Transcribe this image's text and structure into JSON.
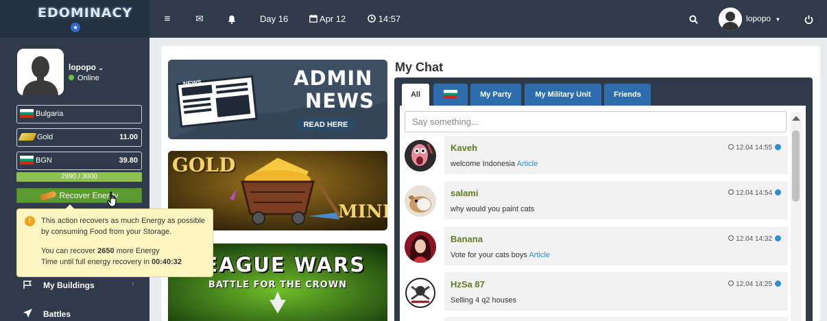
{
  "topbar": {
    "logo_text": "EDOMINACY",
    "day": "Day 16",
    "date": "Apr 12",
    "time": "14:57",
    "username": "lopopo"
  },
  "sidebar": {
    "username": "lopopo",
    "status": "Online",
    "country": "Bulgaria",
    "gold_label": "Gold",
    "gold_value": "11.00",
    "currency_label": "BGN",
    "currency_value": "39.80",
    "energy_text": "2990 / 3000",
    "energy_fraction": 0.997,
    "recover_label": "Recover Energy",
    "tooltip": {
      "line1": "This action recovers as much Energy as possible",
      "line2": "by consuming Food from your Storage.",
      "line3_prefix": "You can recover ",
      "line3_value": "2650",
      "line3_suffix": " more Energy",
      "line4_prefix": "Time until full energy recovery in ",
      "line4_value": "00:40:32"
    },
    "nav": [
      {
        "label": "My Buildings",
        "icon": "flag-icon"
      },
      {
        "label": "Battles",
        "icon": "plane-icon"
      }
    ]
  },
  "banners": {
    "admin_news": {
      "title1": "ADMIN",
      "title2": "NEWS",
      "cta": "READ HERE",
      "paper": "NEWS"
    },
    "gold_mine": {
      "word1": "GOLD",
      "word2": "MINE"
    },
    "league_wars": {
      "line1": "LEAGUE WARS",
      "line2": "BATTLE FOR THE CROWN"
    }
  },
  "chat": {
    "title": "My Chat",
    "tabs": [
      "All",
      "",
      "My Party",
      "My Military Unit",
      "Friends"
    ],
    "placeholder": "Say something...",
    "messages": [
      {
        "name": "Kaveh",
        "text": "welcome Indonesia ",
        "link": "Article",
        "time": "12.04 14:55"
      },
      {
        "name": "salami",
        "text": "why would you paint cats",
        "link": "",
        "time": "12.04 14:54"
      },
      {
        "name": "Banana",
        "text": "Vote for your cats boys ",
        "link": "Article",
        "time": "12.04 14:32"
      },
      {
        "name": "HzSa 87",
        "text": "Selling 4 q2 houses",
        "link": "",
        "time": "12.04 14:25"
      }
    ]
  },
  "colors": {
    "sidebar_bg": "#2f3b4a",
    "accent_green": "#5b9a2e",
    "tab_blue": "#2e6dad",
    "name_green": "#5e7c26",
    "link_blue": "#2d8fd0"
  }
}
